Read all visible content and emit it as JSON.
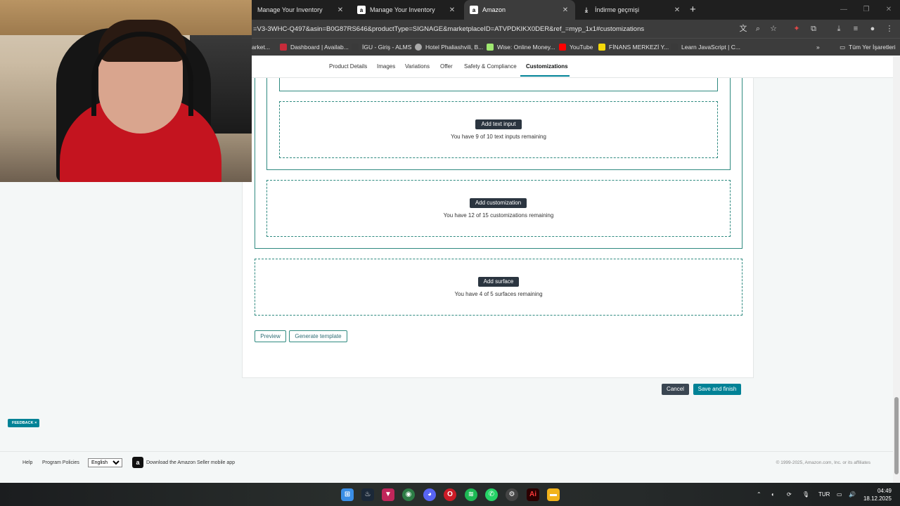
{
  "browser": {
    "tabs": [
      {
        "title": "Manage Your Inventory",
        "icon": "blank"
      },
      {
        "title": "Manage Your Inventory",
        "icon": "amazon-icon"
      },
      {
        "title": "Amazon",
        "icon": "amazon-icon",
        "active": true
      },
      {
        "title": "İndirme geçmişi",
        "icon": "download-icon"
      }
    ],
    "url": "=V3-3WHC-Q497&asin=B0G87RS646&productType=SIGNAGE&marketplaceID=ATVPDKIKX0DER&ref_=myp_1x1#customizations",
    "bookmarks": [
      "arket...",
      "Dashboard | Availab...",
      "İGU - Giriş - ALMS",
      "Hotel Phaliashvili, B...",
      "Wise: Online Money...",
      "YouTube",
      "FİNANS MERKEZİ Y...",
      "Learn JavaScript | C..."
    ],
    "all_bookmarks": "Tüm Yer İşaretleri"
  },
  "subnav": {
    "items": [
      "Product Details",
      "Images",
      "Variations",
      "Offer",
      "Safety & Compliance",
      "Customizations"
    ],
    "active": "Customizations"
  },
  "customization": {
    "add_text_input": "Add text input",
    "text_inputs_remaining": "You have 9 of 10 text inputs remaining",
    "add_customization": "Add customization",
    "customizations_remaining": "You have 12 of 15 customizations remaining",
    "add_surface": "Add surface",
    "surfaces_remaining": "You have 4 of 5 surfaces remaining",
    "preview": "Preview",
    "generate_template": "Generate template",
    "cancel": "Cancel",
    "save_and_finish": "Save and finish"
  },
  "footer": {
    "help": "Help",
    "program_policies": "Program Policies",
    "language": "English",
    "app_download": "Download the Amazon Seller mobile app",
    "copyright": "© 1999-2025, Amazon.com, Inc. or its affiliates",
    "feedback": "FEEDBACK ×"
  },
  "taskbar": {
    "language": "TUR",
    "time": "04:49",
    "date": "18.12.2025"
  },
  "colors": {
    "accent": "#008296",
    "dashed_border": "#2f8a80",
    "dark_button": "#2b3540"
  }
}
